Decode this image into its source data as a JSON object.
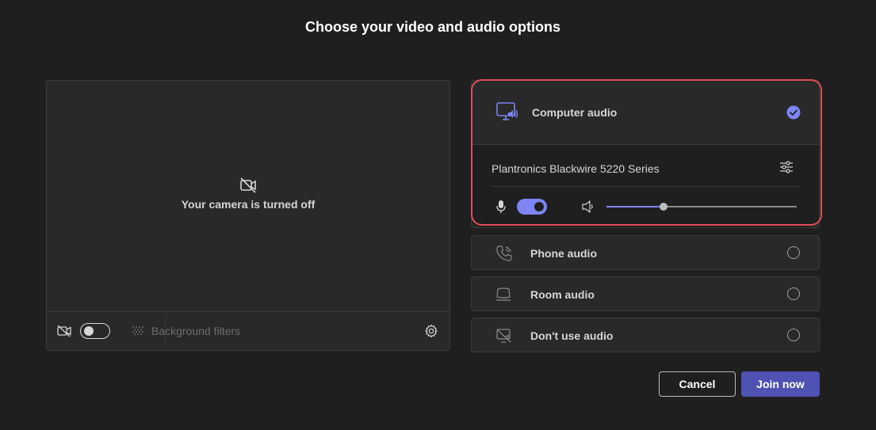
{
  "title": "Choose your video and audio options",
  "video": {
    "camera_off_text": "Your camera is turned off",
    "camera_toggle_on": false,
    "background_filters_label": "Background filters"
  },
  "audio": {
    "computer_audio": {
      "label": "Computer audio",
      "selected": true,
      "device_name": "Plantronics Blackwire 5220 Series",
      "mic_on": true,
      "speaker_volume": 0.3
    },
    "options": [
      {
        "label": "Phone audio",
        "icon": "phone-icon",
        "selected": false
      },
      {
        "label": "Room audio",
        "icon": "room-audio-icon",
        "selected": false
      },
      {
        "label": "Don't use audio",
        "icon": "no-audio-icon",
        "selected": false
      }
    ]
  },
  "buttons": {
    "cancel_label": "Cancel",
    "join_label": "Join now"
  },
  "colors": {
    "background": "#1f1f1f",
    "panel": "#292929",
    "accent": "#7f85f5",
    "primary_button": "#4f52b2",
    "highlight": "#e34c58"
  }
}
